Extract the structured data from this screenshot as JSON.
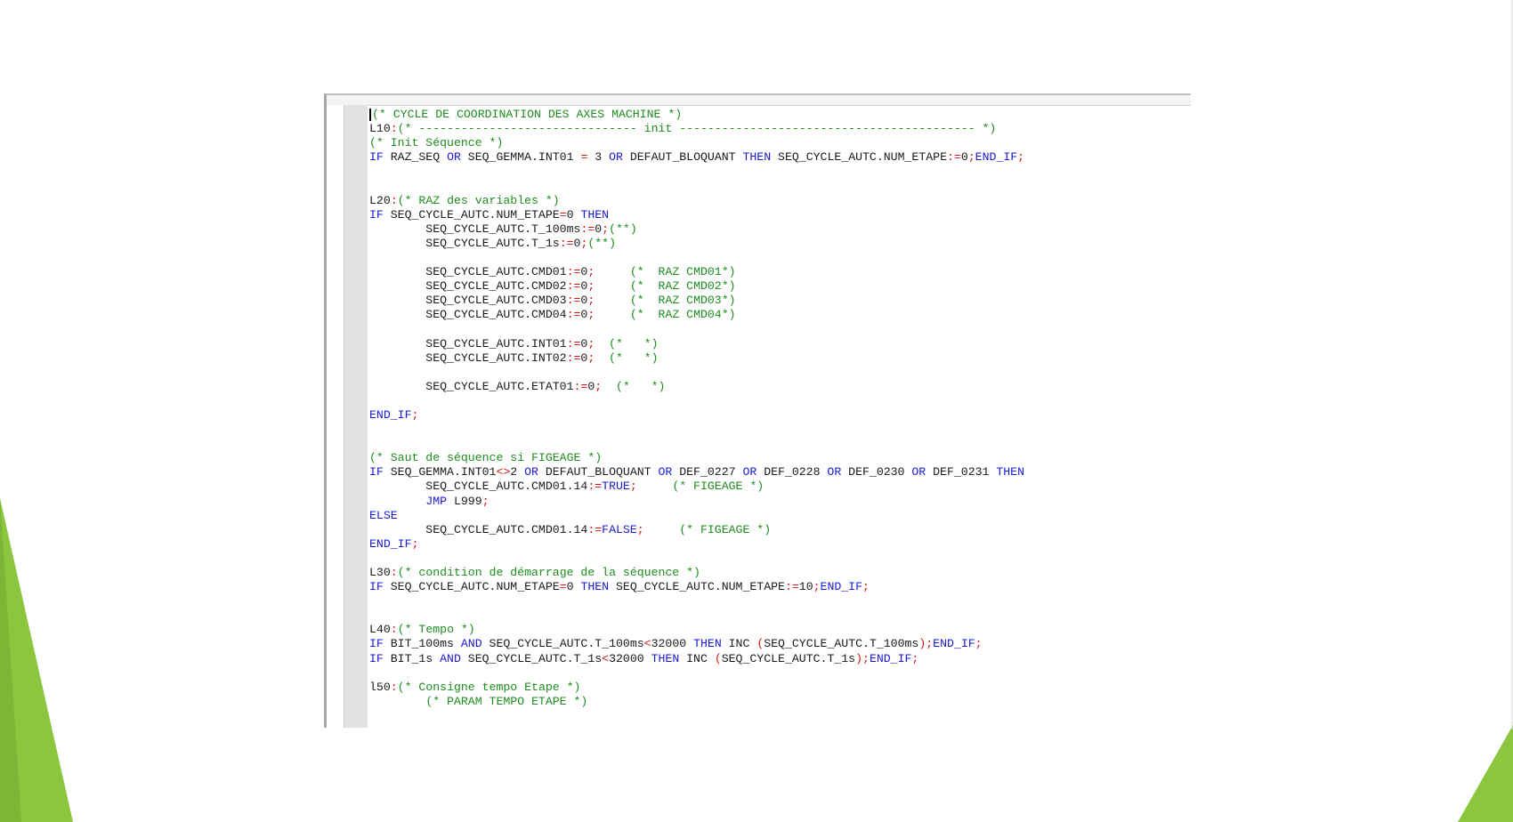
{
  "editor": {
    "lines": [
      [
        {
          "t": "cm",
          "s": "(* CYCLE DE COORDINATION DES AXES MACHINE *)"
        }
      ],
      [
        {
          "t": "code",
          "s": "L10"
        },
        {
          "t": "op",
          "s": ":"
        },
        {
          "t": "cm",
          "s": "(* ------------------------------- init ------------------------------------------ *)"
        }
      ],
      [
        {
          "t": "cm",
          "s": "(* Init Séquence *)"
        }
      ],
      [
        {
          "t": "kw",
          "s": "IF"
        },
        {
          "t": "code",
          "s": " RAZ_SEQ "
        },
        {
          "t": "kw",
          "s": "OR"
        },
        {
          "t": "code",
          "s": " SEQ_GEMMA.INT01 "
        },
        {
          "t": "op",
          "s": "="
        },
        {
          "t": "code",
          "s": " 3 "
        },
        {
          "t": "kw",
          "s": "OR"
        },
        {
          "t": "code",
          "s": " DEFAUT_BLOQUANT "
        },
        {
          "t": "kw",
          "s": "THEN"
        },
        {
          "t": "code",
          "s": " SEQ_CYCLE_AUTC.NUM_ETAPE"
        },
        {
          "t": "op",
          "s": ":="
        },
        {
          "t": "code",
          "s": "0"
        },
        {
          "t": "op",
          "s": ";"
        },
        {
          "t": "kw",
          "s": "END_IF"
        },
        {
          "t": "op",
          "s": ";"
        }
      ],
      [],
      [],
      [
        {
          "t": "code",
          "s": "L20"
        },
        {
          "t": "op",
          "s": ":"
        },
        {
          "t": "cm",
          "s": "(* RAZ des variables *)"
        }
      ],
      [
        {
          "t": "kw",
          "s": "IF"
        },
        {
          "t": "code",
          "s": " SEQ_CYCLE_AUTC.NUM_ETAPE"
        },
        {
          "t": "op",
          "s": "="
        },
        {
          "t": "code",
          "s": "0 "
        },
        {
          "t": "kw",
          "s": "THEN"
        }
      ],
      [
        {
          "t": "code",
          "s": "        SEQ_CYCLE_AUTC.T_100ms"
        },
        {
          "t": "op",
          "s": ":="
        },
        {
          "t": "code",
          "s": "0"
        },
        {
          "t": "op",
          "s": ";"
        },
        {
          "t": "cm",
          "s": "(**)"
        }
      ],
      [
        {
          "t": "code",
          "s": "        SEQ_CYCLE_AUTC.T_1s"
        },
        {
          "t": "op",
          "s": ":="
        },
        {
          "t": "code",
          "s": "0"
        },
        {
          "t": "op",
          "s": ";"
        },
        {
          "t": "cm",
          "s": "(**)"
        }
      ],
      [],
      [
        {
          "t": "code",
          "s": "        SEQ_CYCLE_AUTC.CMD01"
        },
        {
          "t": "op",
          "s": ":="
        },
        {
          "t": "code",
          "s": "0"
        },
        {
          "t": "op",
          "s": ";"
        },
        {
          "t": "code",
          "s": "     "
        },
        {
          "t": "cm",
          "s": "(*  RAZ CMD01*)"
        }
      ],
      [
        {
          "t": "code",
          "s": "        SEQ_CYCLE_AUTC.CMD02"
        },
        {
          "t": "op",
          "s": ":="
        },
        {
          "t": "code",
          "s": "0"
        },
        {
          "t": "op",
          "s": ";"
        },
        {
          "t": "code",
          "s": "     "
        },
        {
          "t": "cm",
          "s": "(*  RAZ CMD02*)"
        }
      ],
      [
        {
          "t": "code",
          "s": "        SEQ_CYCLE_AUTC.CMD03"
        },
        {
          "t": "op",
          "s": ":="
        },
        {
          "t": "code",
          "s": "0"
        },
        {
          "t": "op",
          "s": ";"
        },
        {
          "t": "code",
          "s": "     "
        },
        {
          "t": "cm",
          "s": "(*  RAZ CMD03*)"
        }
      ],
      [
        {
          "t": "code",
          "s": "        SEQ_CYCLE_AUTC.CMD04"
        },
        {
          "t": "op",
          "s": ":="
        },
        {
          "t": "code",
          "s": "0"
        },
        {
          "t": "op",
          "s": ";"
        },
        {
          "t": "code",
          "s": "     "
        },
        {
          "t": "cm",
          "s": "(*  RAZ CMD04*)"
        }
      ],
      [],
      [
        {
          "t": "code",
          "s": "        SEQ_CYCLE_AUTC.INT01"
        },
        {
          "t": "op",
          "s": ":="
        },
        {
          "t": "code",
          "s": "0"
        },
        {
          "t": "op",
          "s": ";"
        },
        {
          "t": "code",
          "s": "  "
        },
        {
          "t": "cm",
          "s": "(*   *)"
        }
      ],
      [
        {
          "t": "code",
          "s": "        SEQ_CYCLE_AUTC.INT02"
        },
        {
          "t": "op",
          "s": ":="
        },
        {
          "t": "code",
          "s": "0"
        },
        {
          "t": "op",
          "s": ";"
        },
        {
          "t": "code",
          "s": "  "
        },
        {
          "t": "cm",
          "s": "(*   *)"
        }
      ],
      [],
      [
        {
          "t": "code",
          "s": "        SEQ_CYCLE_AUTC.ETAT01"
        },
        {
          "t": "op",
          "s": ":="
        },
        {
          "t": "code",
          "s": "0"
        },
        {
          "t": "op",
          "s": ";"
        },
        {
          "t": "code",
          "s": "  "
        },
        {
          "t": "cm",
          "s": "(*   *)"
        }
      ],
      [],
      [
        {
          "t": "kw",
          "s": "END_IF"
        },
        {
          "t": "op",
          "s": ";"
        }
      ],
      [],
      [],
      [
        {
          "t": "cm",
          "s": "(* Saut de séquence si FIGEAGE *)"
        }
      ],
      [
        {
          "t": "kw",
          "s": "IF"
        },
        {
          "t": "code",
          "s": " SEQ_GEMMA.INT01"
        },
        {
          "t": "op",
          "s": "<>"
        },
        {
          "t": "code",
          "s": "2 "
        },
        {
          "t": "kw",
          "s": "OR"
        },
        {
          "t": "code",
          "s": " DEFAUT_BLOQUANT "
        },
        {
          "t": "kw",
          "s": "OR"
        },
        {
          "t": "code",
          "s": " DEF_0227 "
        },
        {
          "t": "kw",
          "s": "OR"
        },
        {
          "t": "code",
          "s": " DEF_0228 "
        },
        {
          "t": "kw",
          "s": "OR"
        },
        {
          "t": "code",
          "s": " DEF_0230 "
        },
        {
          "t": "kw",
          "s": "OR"
        },
        {
          "t": "code",
          "s": " DEF_0231 "
        },
        {
          "t": "kw",
          "s": "THEN"
        }
      ],
      [
        {
          "t": "code",
          "s": "        SEQ_CYCLE_AUTC.CMD01.14"
        },
        {
          "t": "op",
          "s": ":="
        },
        {
          "t": "kw",
          "s": "TRUE"
        },
        {
          "t": "op",
          "s": ";"
        },
        {
          "t": "code",
          "s": "     "
        },
        {
          "t": "cm",
          "s": "(* FIGEAGE *)"
        }
      ],
      [
        {
          "t": "code",
          "s": "        "
        },
        {
          "t": "kw",
          "s": "JMP"
        },
        {
          "t": "code",
          "s": " L999"
        },
        {
          "t": "op",
          "s": ";"
        }
      ],
      [
        {
          "t": "kw",
          "s": "ELSE"
        }
      ],
      [
        {
          "t": "code",
          "s": "        SEQ_CYCLE_AUTC.CMD01.14"
        },
        {
          "t": "op",
          "s": ":="
        },
        {
          "t": "kw",
          "s": "FALSE"
        },
        {
          "t": "op",
          "s": ";"
        },
        {
          "t": "code",
          "s": "     "
        },
        {
          "t": "cm",
          "s": "(* FIGEAGE *)"
        }
      ],
      [
        {
          "t": "kw",
          "s": "END_IF"
        },
        {
          "t": "op",
          "s": ";"
        }
      ],
      [],
      [
        {
          "t": "code",
          "s": "L30"
        },
        {
          "t": "op",
          "s": ":"
        },
        {
          "t": "cm",
          "s": "(* condition de démarrage de la séquence *)"
        }
      ],
      [
        {
          "t": "kw",
          "s": "IF"
        },
        {
          "t": "code",
          "s": " SEQ_CYCLE_AUTC.NUM_ETAPE"
        },
        {
          "t": "op",
          "s": "="
        },
        {
          "t": "code",
          "s": "0 "
        },
        {
          "t": "kw",
          "s": "THEN"
        },
        {
          "t": "code",
          "s": " SEQ_CYCLE_AUTC.NUM_ETAPE"
        },
        {
          "t": "op",
          "s": ":="
        },
        {
          "t": "code",
          "s": "10"
        },
        {
          "t": "op",
          "s": ";"
        },
        {
          "t": "kw",
          "s": "END_IF"
        },
        {
          "t": "op",
          "s": ";"
        }
      ],
      [],
      [],
      [
        {
          "t": "code",
          "s": "L40"
        },
        {
          "t": "op",
          "s": ":"
        },
        {
          "t": "cm",
          "s": "(* Tempo *)"
        }
      ],
      [
        {
          "t": "kw",
          "s": "IF"
        },
        {
          "t": "code",
          "s": " BIT_100ms "
        },
        {
          "t": "kw",
          "s": "AND"
        },
        {
          "t": "code",
          "s": " SEQ_CYCLE_AUTC.T_100ms"
        },
        {
          "t": "op",
          "s": "<"
        },
        {
          "t": "code",
          "s": "32000 "
        },
        {
          "t": "kw",
          "s": "THEN"
        },
        {
          "t": "code",
          "s": " INC "
        },
        {
          "t": "op",
          "s": "("
        },
        {
          "t": "code",
          "s": "SEQ_CYCLE_AUTC.T_100ms"
        },
        {
          "t": "op",
          "s": ");"
        },
        {
          "t": "kw",
          "s": "END_IF"
        },
        {
          "t": "op",
          "s": ";"
        }
      ],
      [
        {
          "t": "kw",
          "s": "IF"
        },
        {
          "t": "code",
          "s": " BIT_1s "
        },
        {
          "t": "kw",
          "s": "AND"
        },
        {
          "t": "code",
          "s": " SEQ_CYCLE_AUTC.T_1s"
        },
        {
          "t": "op",
          "s": "<"
        },
        {
          "t": "code",
          "s": "32000 "
        },
        {
          "t": "kw",
          "s": "THEN"
        },
        {
          "t": "code",
          "s": " INC "
        },
        {
          "t": "op",
          "s": "("
        },
        {
          "t": "code",
          "s": "SEQ_CYCLE_AUTC.T_1s"
        },
        {
          "t": "op",
          "s": ");"
        },
        {
          "t": "kw",
          "s": "END_IF"
        },
        {
          "t": "op",
          "s": ";"
        }
      ],
      [],
      [
        {
          "t": "code",
          "s": "l50"
        },
        {
          "t": "op",
          "s": ":"
        },
        {
          "t": "cm",
          "s": "(* Consigne tempo Etape *)"
        }
      ],
      [
        {
          "t": "code",
          "s": "        "
        },
        {
          "t": "cm",
          "s": "(* PARAM TEMPO ETAPE *)"
        }
      ]
    ]
  },
  "colors": {
    "keyword": "#1a1ad6",
    "comment": "#1e8c1e",
    "operator": "#d01818",
    "text": "#1a1a1a",
    "accent_green": "#8cc63e"
  }
}
